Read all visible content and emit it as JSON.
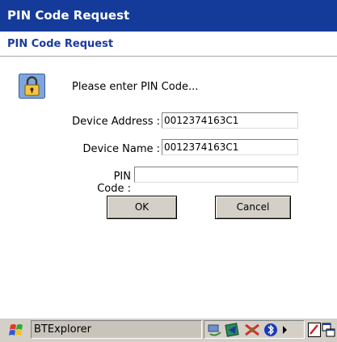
{
  "window": {
    "title": "PIN Code Request"
  },
  "dialog": {
    "heading": "PIN Code Request",
    "prompt": "Please enter PIN Code...",
    "device_address_label": "Device Address :",
    "device_address_value": "0012374163C1",
    "device_name_label": "Device Name :",
    "device_name_value": "0012374163C1",
    "pin_code_label": "PIN Code :",
    "pin_code_value": "",
    "ok_label": "OK",
    "cancel_label": "Cancel"
  },
  "taskbar": {
    "active_app": "BTExplorer",
    "tray_icons": [
      "network-icon",
      "bluetooth-device-icon",
      "bluetooth-status-icon",
      "arrow-icon",
      "pen-icon",
      "windows-icon"
    ]
  },
  "colors": {
    "titlebar": "#153b9a",
    "heading": "#1a3aa0",
    "button_face": "#d4d0c8"
  }
}
